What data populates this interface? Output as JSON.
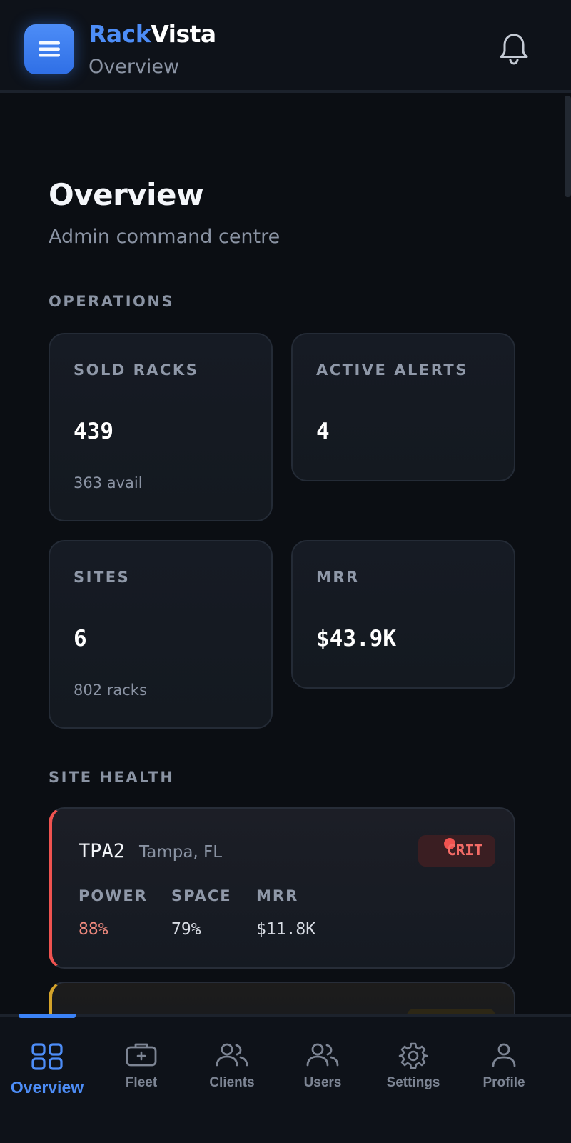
{
  "header": {
    "brand_part1": "Rack",
    "brand_part2": "Vista",
    "subtitle": "Overview"
  },
  "page": {
    "title": "Overview",
    "subtitle": "Admin command centre"
  },
  "operations": {
    "section_label": "OPERATIONS",
    "cards": [
      {
        "label": "SOLD RACKS",
        "value": "439",
        "note": "363 avail"
      },
      {
        "label": "ACTIVE ALERTS",
        "value": "4"
      },
      {
        "label": "SITES",
        "value": "6",
        "note": "802 racks"
      },
      {
        "label": "MRR",
        "value": "$43.9K"
      }
    ]
  },
  "site_health": {
    "section_label": "SITE HEALTH",
    "sites": [
      {
        "code": "TPA2",
        "location": "Tampa, FL",
        "status": "CRIT",
        "status_color": "#ef5350",
        "metrics": [
          {
            "label": "POWER",
            "value": "88%"
          },
          {
            "label": "SPACE",
            "value": "79%"
          },
          {
            "label": "MRR",
            "value": "$11.8K"
          }
        ]
      }
    ]
  },
  "bottom_nav": {
    "items": [
      {
        "label": "Overview",
        "icon": "grid-icon",
        "active": true
      },
      {
        "label": "Fleet",
        "icon": "server-rack-icon"
      },
      {
        "label": "Clients",
        "icon": "clients-icon"
      },
      {
        "label": "Users",
        "icon": "users-icon"
      },
      {
        "label": "Settings",
        "icon": "gear-icon"
      },
      {
        "label": "Profile",
        "icon": "person-icon"
      }
    ]
  },
  "colors": {
    "accent": "#3b82f6",
    "critical": "#ef5350",
    "warning": "#d4a32a",
    "background": "#0b0e13"
  }
}
